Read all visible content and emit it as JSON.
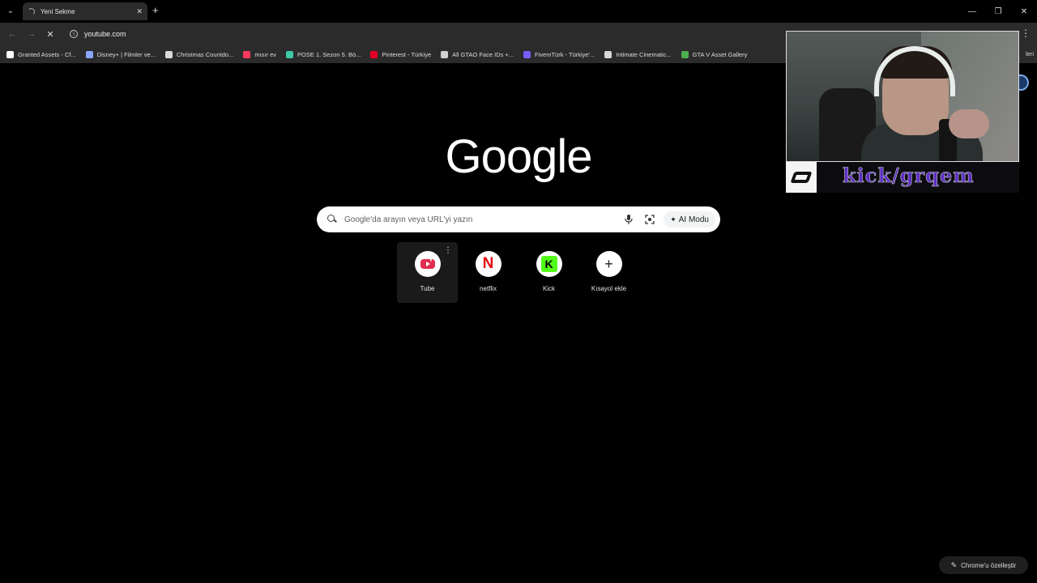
{
  "tab": {
    "title": "Yeni Sekme"
  },
  "toolbar": {
    "url": "youtube.com"
  },
  "bookmarks": [
    {
      "label": "Granted Assets - Cf...",
      "icon": "granted-assets-icon",
      "color": "#ffffff"
    },
    {
      "label": "Disney+ | Filmler ve...",
      "icon": "disney-plus-icon",
      "color": "#8aa7ff"
    },
    {
      "label": "Christmas Countdo...",
      "icon": "star-icon",
      "color": "#d8d8d8"
    },
    {
      "label": "mısır ev",
      "icon": "airbnb-icon",
      "color": "#ff385c"
    },
    {
      "label": "POSE 1. Sezon 5. Bö...",
      "icon": "pose-icon",
      "color": "#3ec9a7"
    },
    {
      "label": "Pinterest - Türkiye",
      "icon": "pinterest-icon",
      "color": "#e60023"
    },
    {
      "label": "All GTAO Face IDs +...",
      "icon": "gtao-icon",
      "color": "#cfcfcf"
    },
    {
      "label": "FivemTürk - Türkiye'...",
      "icon": "fivem-icon",
      "color": "#7a5cff"
    },
    {
      "label": "Intimate Cinematic...",
      "icon": "moon-icon",
      "color": "#d8d8d8"
    },
    {
      "label": "GTA V Asset Gallery",
      "icon": "gta-gallery-icon",
      "color": "#4caf50"
    }
  ],
  "bookmarks_more": "leri",
  "logo": "Google",
  "search": {
    "placeholder": "Google'da arayın veya URL'yi yazın",
    "ai_mode_label": "AI Modu"
  },
  "shortcuts": [
    {
      "label": "Tube",
      "icon": "youtube-icon"
    },
    {
      "label": "netflix",
      "icon": "netflix-icon"
    },
    {
      "label": "Kick",
      "icon": "kick-icon"
    },
    {
      "label": "Kısayol ekle",
      "icon": "plus-icon"
    }
  ],
  "icon_glyphs": {
    "netflix": "N",
    "kick": "K",
    "add": "+"
  },
  "customize_label": "Chrome'u özelleştir",
  "overlay": {
    "channel": "kick/grqem"
  },
  "colors": {
    "background": "#000000",
    "toolbar": "#2b2b2b",
    "kick_green": "#53fc18",
    "netflix_red": "#e50914",
    "youtube_red": "#e02d50"
  }
}
